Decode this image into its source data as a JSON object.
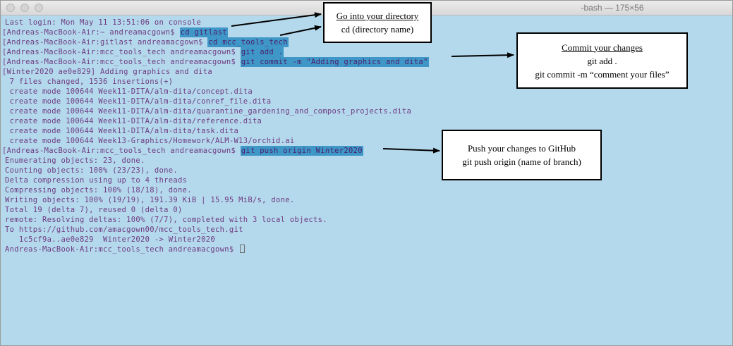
{
  "window": {
    "title": "-bash — 175×56"
  },
  "terminal": {
    "lines": [
      {
        "before": "Last login: Mon May 11 13:51:06 on console",
        "cmd": "",
        "after": ""
      },
      {
        "before": "[Andreas-MacBook-Air:~ andreamacgown$ ",
        "cmd": "cd gitlast",
        "after": ""
      },
      {
        "before": "[Andreas-MacBook-Air:gitlast andreamacgown$ ",
        "cmd": "cd mcc_tools_tech",
        "after": ""
      },
      {
        "before": "[Andreas-MacBook-Air:mcc_tools_tech andreamacgown$ ",
        "cmd": "git add .",
        "after": ""
      },
      {
        "before": "[Andreas-MacBook-Air:mcc_tools_tech andreamacgown$ ",
        "cmd": "git commit -m \"Adding graphics and dita\"",
        "after": ""
      },
      {
        "before": "[Winter2020 ae0e829] Adding graphics and dita",
        "cmd": "",
        "after": ""
      },
      {
        "before": " 7 files changed, 1536 insertions(+)",
        "cmd": "",
        "after": ""
      },
      {
        "before": " create mode 100644 Week11-DITA/alm-dita/concept.dita",
        "cmd": "",
        "after": ""
      },
      {
        "before": " create mode 100644 Week11-DITA/alm-dita/conref_file.dita",
        "cmd": "",
        "after": ""
      },
      {
        "before": " create mode 100644 Week11-DITA/alm-dita/quarantine_gardening_and_compost_projects.dita",
        "cmd": "",
        "after": ""
      },
      {
        "before": " create mode 100644 Week11-DITA/alm-dita/reference.dita",
        "cmd": "",
        "after": ""
      },
      {
        "before": " create mode 100644 Week11-DITA/alm-dita/task.dita",
        "cmd": "",
        "after": ""
      },
      {
        "before": " create mode 100644 Week13-Graphics/Homework/ALM-W13/orchid.ai",
        "cmd": "",
        "after": ""
      },
      {
        "before": "[Andreas-MacBook-Air:mcc_tools_tech andreamacgown$ ",
        "cmd": "git push origin Winter2020",
        "after": ""
      },
      {
        "before": "Enumerating objects: 23, done.",
        "cmd": "",
        "after": ""
      },
      {
        "before": "Counting objects: 100% (23/23), done.",
        "cmd": "",
        "after": ""
      },
      {
        "before": "Delta compression using up to 4 threads",
        "cmd": "",
        "after": ""
      },
      {
        "before": "Compressing objects: 100% (18/18), done.",
        "cmd": "",
        "after": ""
      },
      {
        "before": "Writing objects: 100% (19/19), 191.39 KiB | 15.95 MiB/s, done.",
        "cmd": "",
        "after": ""
      },
      {
        "before": "Total 19 (delta 7), reused 0 (delta 0)",
        "cmd": "",
        "after": ""
      },
      {
        "before": "remote: Resolving deltas: 100% (7/7), completed with 3 local objects.",
        "cmd": "",
        "after": ""
      },
      {
        "before": "To https://github.com/amacgown00/mcc_tools_tech.git",
        "cmd": "",
        "after": ""
      },
      {
        "before": "   1c5cf9a..ae0e829  Winter2020 -> Winter2020",
        "cmd": "",
        "after": ""
      },
      {
        "before": "Andreas-MacBook-Air:mcc_tools_tech andreamacgown$ ",
        "cmd": "",
        "after": ""
      }
    ]
  },
  "callouts": {
    "directory": {
      "title": "Go into your directory",
      "body": "cd (directory name)"
    },
    "commit": {
      "title": "Commit your changes",
      "line1": "git add .",
      "line2": "git commit -m “comment your files”"
    },
    "push": {
      "line1": "Push your changes to GitHub",
      "line2": "git push origin (name of branch)"
    }
  },
  "colors": {
    "background": "#b4d9ec",
    "text": "#6e3b82",
    "highlight": "#3f97c8"
  }
}
